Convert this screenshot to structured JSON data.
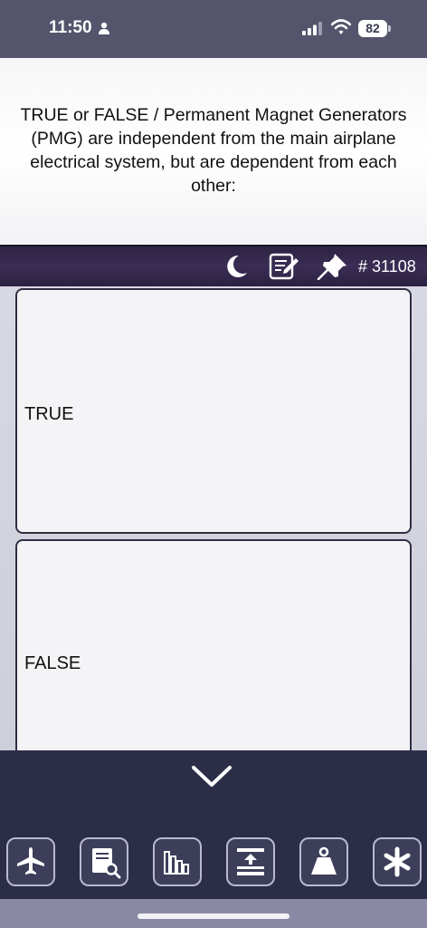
{
  "status_bar": {
    "time": "11:50",
    "battery": "82",
    "icons": [
      "person-icon",
      "signal-icon",
      "wifi-icon",
      "battery-icon"
    ]
  },
  "question": {
    "text": "TRUE or FALSE / Permanent Magnet Generators (PMG) are independent from the main airplane electrical system, but are dependent from each other:"
  },
  "toolbar": {
    "icons": [
      "moon-icon",
      "notes-icon",
      "pin-icon"
    ],
    "question_id": "# 31108"
  },
  "answers": [
    {
      "label": "TRUE"
    },
    {
      "label": "FALSE"
    }
  ],
  "bottom_nav": {
    "collapse_icon": "chevron-down-icon",
    "items": [
      "airplane-icon",
      "book-search-icon",
      "stats-icon",
      "sort-icon",
      "weight-icon",
      "asterisk-icon"
    ]
  },
  "colors": {
    "toolbar_bg": "#2d2342",
    "nav_bg": "#2c2e48",
    "card_border": "#2f2f44"
  }
}
